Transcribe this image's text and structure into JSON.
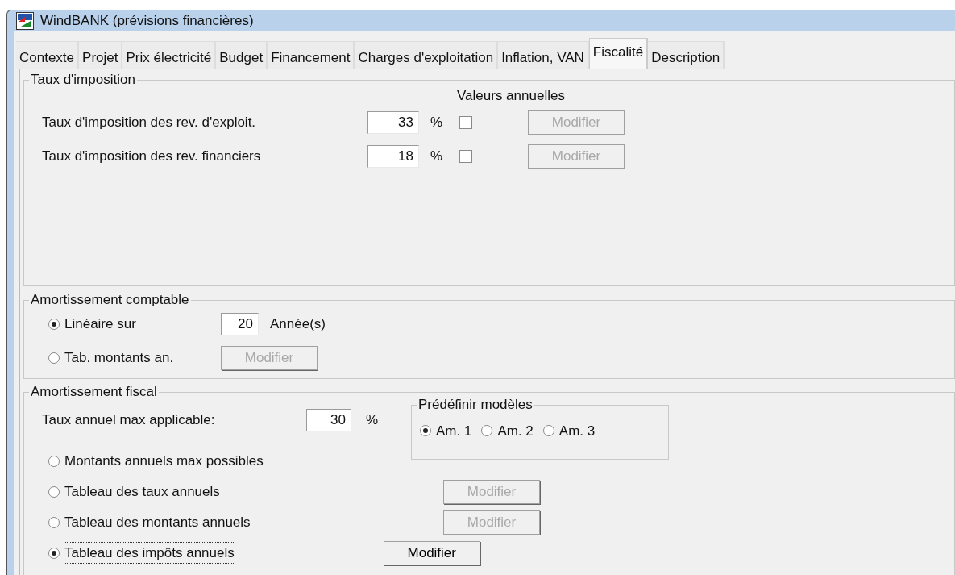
{
  "window": {
    "title": "WindBANK (prévisions financières)"
  },
  "tabs": [
    {
      "label": "Contexte",
      "selected": false
    },
    {
      "label": "Projet",
      "selected": false
    },
    {
      "label": "Prix électricité",
      "selected": false
    },
    {
      "label": "Budget",
      "selected": false
    },
    {
      "label": "Financement",
      "selected": false
    },
    {
      "label": "Charges d'exploitation",
      "selected": false
    },
    {
      "label": "Inflation, VAN",
      "selected": false
    },
    {
      "label": "Fiscalité",
      "selected": true
    },
    {
      "label": "Description",
      "selected": false
    }
  ],
  "taux_imposition": {
    "title": "Taux d'imposition",
    "column_header": "Valeurs annuelles",
    "rows": [
      {
        "label": "Taux d'imposition des rev. d'exploit.",
        "value": "33",
        "unit": "%",
        "checked": false,
        "button": {
          "label": "Modifier",
          "disabled": true
        }
      },
      {
        "label": "Taux d'imposition des rev. financiers",
        "value": "18",
        "unit": "%",
        "checked": false,
        "button": {
          "label": "Modifier",
          "disabled": true
        }
      }
    ]
  },
  "amortissement_comptable": {
    "title": "Amortissement comptable",
    "options": [
      {
        "kind": "field",
        "label": "Linéaire sur",
        "selected": true,
        "value": "20",
        "unit": "Année(s)"
      },
      {
        "kind": "button",
        "label": "Tab. montants an.",
        "selected": false,
        "button": {
          "label": "Modifier",
          "disabled": true
        }
      }
    ]
  },
  "amortissement_fiscal": {
    "title": "Amortissement fiscal",
    "rate_label": "Taux annuel max applicable:",
    "rate_value": "30",
    "rate_unit": "%",
    "models": {
      "title": "Prédéfinir modèles",
      "options": [
        {
          "label": "Am. 1",
          "selected": true
        },
        {
          "label": "Am. 2",
          "selected": false
        },
        {
          "label": "Am. 3",
          "selected": false
        }
      ]
    },
    "options": [
      {
        "label": "Montants annuels max possibles",
        "selected": false,
        "focused": false
      },
      {
        "label": "Tableau des taux annuels",
        "selected": false,
        "focused": false,
        "button": {
          "label": "Modifier",
          "disabled": true
        }
      },
      {
        "label": "Tableau des montants annuels",
        "selected": false,
        "focused": false,
        "button": {
          "label": "Modifier",
          "disabled": true
        }
      },
      {
        "label": "Tableau des impôts annuels",
        "selected": true,
        "focused": true,
        "button": {
          "label": "Modifier",
          "disabled": false
        }
      }
    ]
  }
}
